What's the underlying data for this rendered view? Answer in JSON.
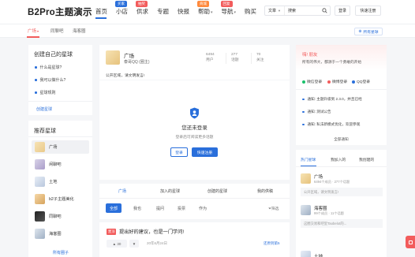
{
  "header": {
    "logo": "B2Pro主题演示",
    "nav": [
      {
        "label": "首页",
        "badge": "",
        "badge_color": ""
      },
      {
        "label": "小店",
        "badge": "买家",
        "badge_color": "#2a6fdb"
      },
      {
        "label": "供求",
        "badge": "抽奖",
        "badge_color": "#f25c5c"
      },
      {
        "label": "专题",
        "badge": "",
        "badge_color": ""
      },
      {
        "label": "快报",
        "badge": "",
        "badge_color": ""
      },
      {
        "label": "帮助",
        "badge": "商城",
        "badge_color": "#ff8a3d"
      },
      {
        "label": "导航",
        "badge": "回复",
        "badge_color": "#f25c5c"
      },
      {
        "label": "购买",
        "badge": "",
        "badge_color": ""
      }
    ],
    "search_type": "文章",
    "search_placeholder": "搜索",
    "login_label": "登录",
    "register_label": "快速注册"
  },
  "subnav": {
    "tabs": [
      {
        "label": "广场",
        "active": true
      },
      {
        "label": "同聊吧",
        "active": false
      },
      {
        "label": "海客圈",
        "active": false
      }
    ],
    "all_circles_label": "所有星球"
  },
  "left": {
    "create_title": "创建自己的星球",
    "create_items": [
      "什么是星球?",
      "我可以做什么?",
      "星球规则"
    ],
    "create_link": "创建星球",
    "recommend_title": "推荐星球",
    "recommend_items": [
      "广场",
      "闲聊吧",
      "土地",
      "b2子主题美化",
      "同聊吧",
      "海客圈"
    ],
    "more_label": "所有圈子"
  },
  "circle": {
    "name": "广场",
    "owner": "泰哥QQ (圈主)",
    "stats": [
      {
        "value": "6494",
        "label": "用户"
      },
      {
        "value": "277",
        "label": "话题"
      },
      {
        "value": "70",
        "label": "关注"
      }
    ],
    "desc": "公开区域，请文明发言!",
    "login_title": "您还未登录",
    "login_sub": "登录后可阅读更多话题",
    "login_btn": "登录",
    "register_btn": "快速注册"
  },
  "feed": {
    "tabs": [
      "广场",
      "加入的星球",
      "创建的星球",
      "我的供稿"
    ],
    "filters": [
      "全部",
      "我也",
      "提问",
      "投票",
      "作为"
    ],
    "filter_label": "筛选",
    "post_tag": "置顶",
    "post_title": "提出好的建议，也是一门学问!",
    "post_likes": "30",
    "post_date": "20年6月24日",
    "post_more": "还原到第5"
  },
  "right": {
    "greeting": "嗨! 朋友",
    "greeting_sub": "所有的伟大，都源于一个勇敢的开始",
    "social": [
      {
        "label": "微信登录",
        "color": "#19c16b"
      },
      {
        "label": "微博登录",
        "color": "#f25c5c"
      },
      {
        "label": "QQ登录",
        "color": "#2a6fdb"
      }
    ],
    "notices": [
      "通知: 主题升级到 2.3.0，并且已经",
      "通知: 测试公告",
      "通知: 私法新模式优化，欢迎参观"
    ],
    "all_notice": "全部通知",
    "tabs": [
      "热门星球",
      "我加入的",
      "我创建的"
    ],
    "planets": [
      {
        "name": "广场",
        "meta": "6494个成员 · 277个话题",
        "desc": "公开区域，请文明发言!"
      },
      {
        "name": "海客圈",
        "meta": "99个成员 · 11个话题",
        "desc": "这圈交易和吧里Taobelot的..."
      },
      {
        "name": "土地",
        "meta": "",
        "desc": ""
      }
    ]
  }
}
